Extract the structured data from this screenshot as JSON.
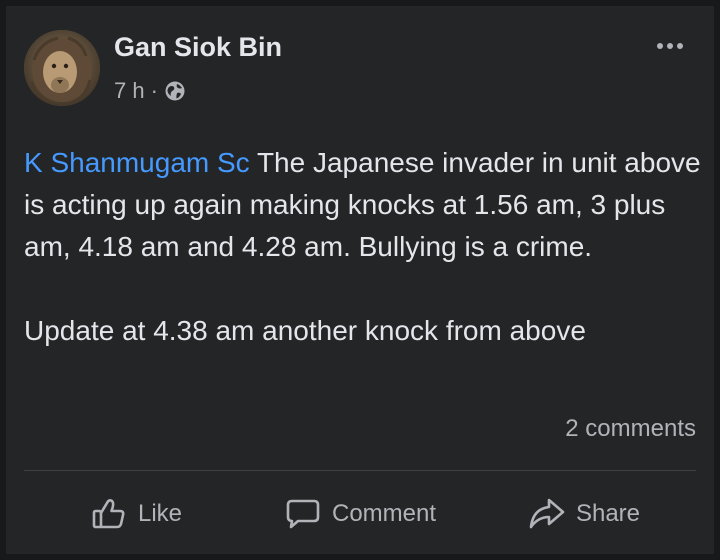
{
  "post": {
    "author": "Gan Siok Bin",
    "time": "7 h",
    "separator": "·",
    "avatar_icon": "lion-avatar",
    "privacy_icon": "globe-icon",
    "more_icon": "more-dots-icon",
    "mention": "K Shanmugam Sc",
    "text_main": " The Japanese invader in unit above is acting up again making knocks at 1.56 am, 3 plus am, 4.18 am and 4.28 am. Bullying is a crime.",
    "text_update": "Update at 4.38 am another knock from above",
    "comments_count": "2 comments"
  },
  "actions": {
    "like": "Like",
    "comment": "Comment",
    "share": "Share"
  },
  "colors": {
    "background": "#18191a",
    "card": "#242526",
    "primary_text": "#e4e6eb",
    "secondary_text": "#b0b3b8",
    "link": "#4599ff"
  }
}
